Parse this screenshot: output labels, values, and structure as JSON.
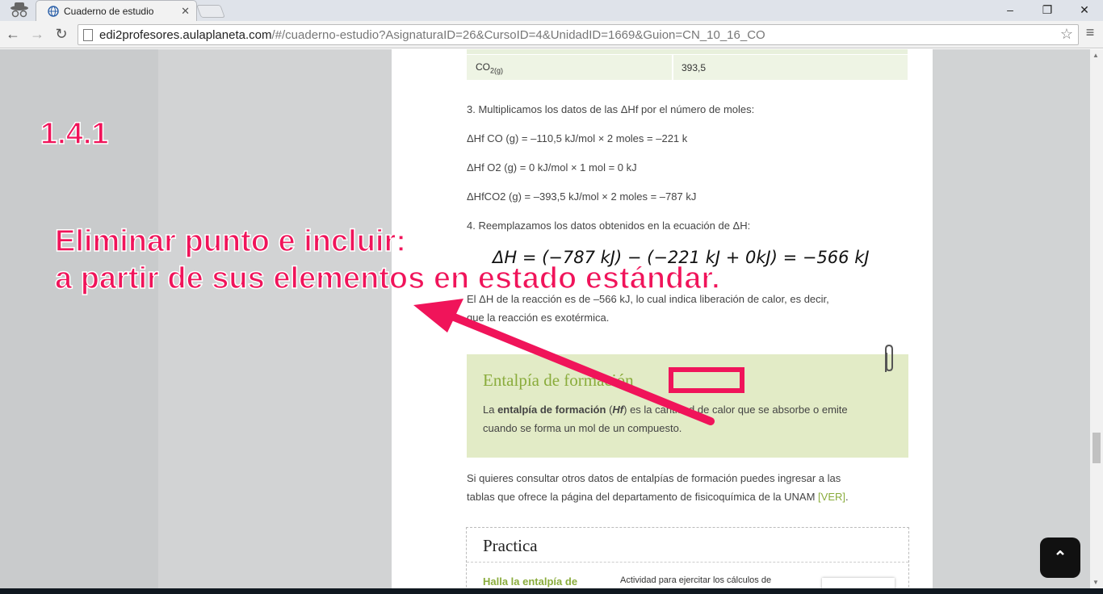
{
  "browser": {
    "tab_title": "Cuaderno de estudio",
    "url_host": "edi2profesores.aulaplaneta.com",
    "url_path": "/#/cuaderno-estudio?AsignaturaID=26&CursoID=4&UnidadID=1669&Guion=CN_10_16_CO"
  },
  "table": {
    "row_label": "CO",
    "row_label_sub": "2(g)",
    "row_value": "393,5"
  },
  "content": {
    "step3": "3. Multiplicamos los datos de las ΔHf por el número de moles:",
    "calc1": "ΔHf CO (g) = –110,5 kJ/mol × 2 moles = –221 k",
    "calc2": "ΔHf O2 (g) = 0 kJ/mol × 1 mol = 0 kJ",
    "calc3": "ΔHfCO2 (g) = –393,5 kJ/mol × 2 moles = –787 kJ",
    "step4": "4. Reemplazamos los datos obtenidos en la ecuación de ΔH:",
    "equation": "ΔH = (−787 kJ) − (−221 kJ + 0kJ) = −566 kJ",
    "result_1": "El ΔH de la reacción es de –566 kJ, lo cual indica liberación de calor, es decir,",
    "result_2": "que la reacción es exotérmica."
  },
  "definition": {
    "title": "Entalpía de formación",
    "text_1": "La ",
    "term": "entalpía de formación",
    "text_2": " (",
    "symbol": "Hf",
    "text_3": ") es la cantidad de calor que se absorbe o emite cuando se forma un mol de un compuesto."
  },
  "consult": {
    "line_1": "Si quieres consultar otros datos de entalpías de formación puedes ingresar a las",
    "line_2": "tablas que ofrece la página del departamento de fisicoquímica de la UNAM ",
    "link": "[VER]",
    "end": "."
  },
  "practice": {
    "title": "Practica",
    "item": "Halla la entalpía de",
    "desc": "Actividad para ejercitar los cálculos de"
  },
  "annotation": {
    "number": "1.4.1",
    "line_1": "Eliminar punto e incluir:",
    "line_2": "a partir de sus elementos en estado estándar."
  },
  "colors": {
    "accent_green": "#8aac3c",
    "annotation_pink": "#f0145a",
    "box_bg": "#e2ebc6"
  },
  "icons": [
    "incognito-icon",
    "globe-icon",
    "back-icon",
    "forward-icon",
    "reload-icon",
    "star-icon",
    "menu-icon",
    "paperclip-icon",
    "scroll-top-icon"
  ]
}
